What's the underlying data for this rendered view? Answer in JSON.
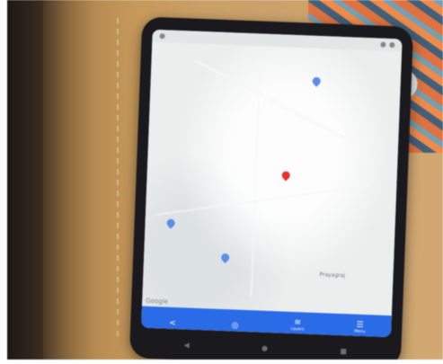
{
  "map": {
    "place_label": "Prayagraj",
    "place_label_2": "",
    "google_logo": "Google"
  },
  "bottom_bar": {
    "buttons": [
      {
        "icon": "share-icon",
        "label": ""
      },
      {
        "icon": "directions-icon",
        "label": ""
      },
      {
        "icon": "layers-icon",
        "label": "Layers"
      },
      {
        "icon": "menu-icon",
        "label": "Menu"
      }
    ]
  },
  "colors": {
    "bar": "#2a6be8",
    "pin_red": "#e7312b",
    "pin_blue": "#5c8de8",
    "pin_green": "#2e9d4f"
  }
}
